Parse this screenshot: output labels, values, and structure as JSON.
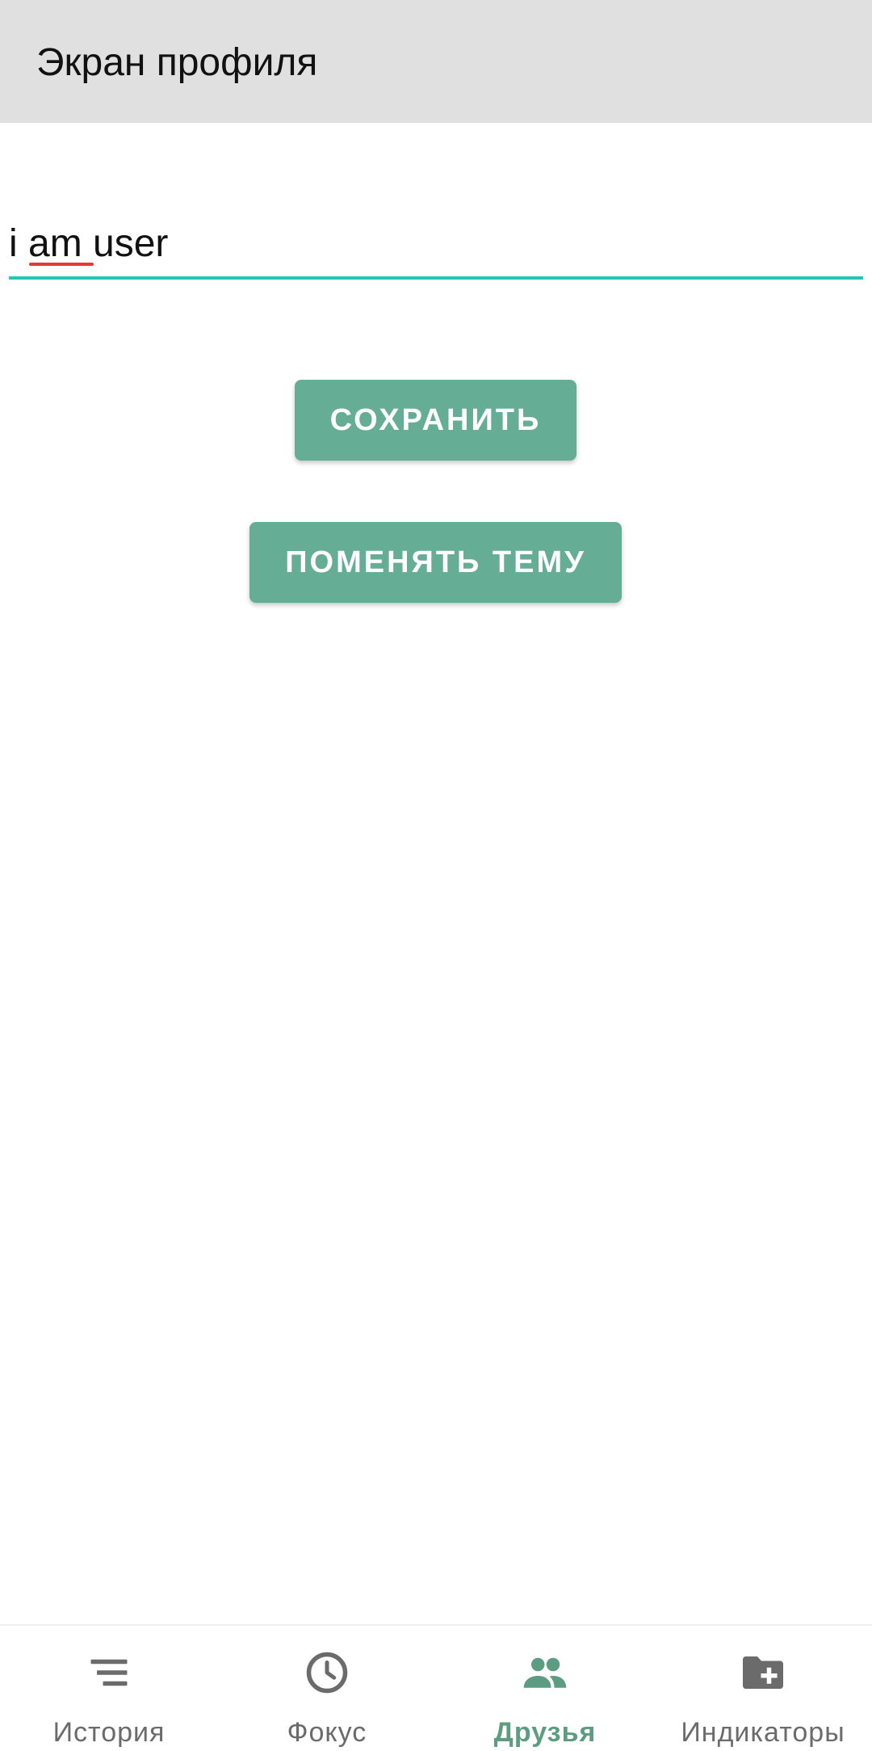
{
  "app_bar": {
    "title": "Экран профиля"
  },
  "profile": {
    "username_value": "i am user"
  },
  "buttons": {
    "save_label": "СОХРАНИТЬ",
    "change_theme_label": "ПОМЕНЯТЬ ТЕМУ"
  },
  "bottom_nav": {
    "items": [
      {
        "label": "История",
        "icon": "sort-lines-icon",
        "active": false
      },
      {
        "label": "Фокус",
        "icon": "clock-icon",
        "active": false
      },
      {
        "label": "Друзья",
        "icon": "people-icon",
        "active": true
      },
      {
        "label": "Индикаторы",
        "icon": "folder-add-icon",
        "active": false
      }
    ]
  },
  "colors": {
    "app_bar_bg": "#e0e0e0",
    "accent_button": "#65ad95",
    "field_underline": "#26c6b7",
    "nav_active": "#5c9c82",
    "nav_inactive": "#6b6b6b",
    "spellcheck_underline": "#e53935"
  }
}
